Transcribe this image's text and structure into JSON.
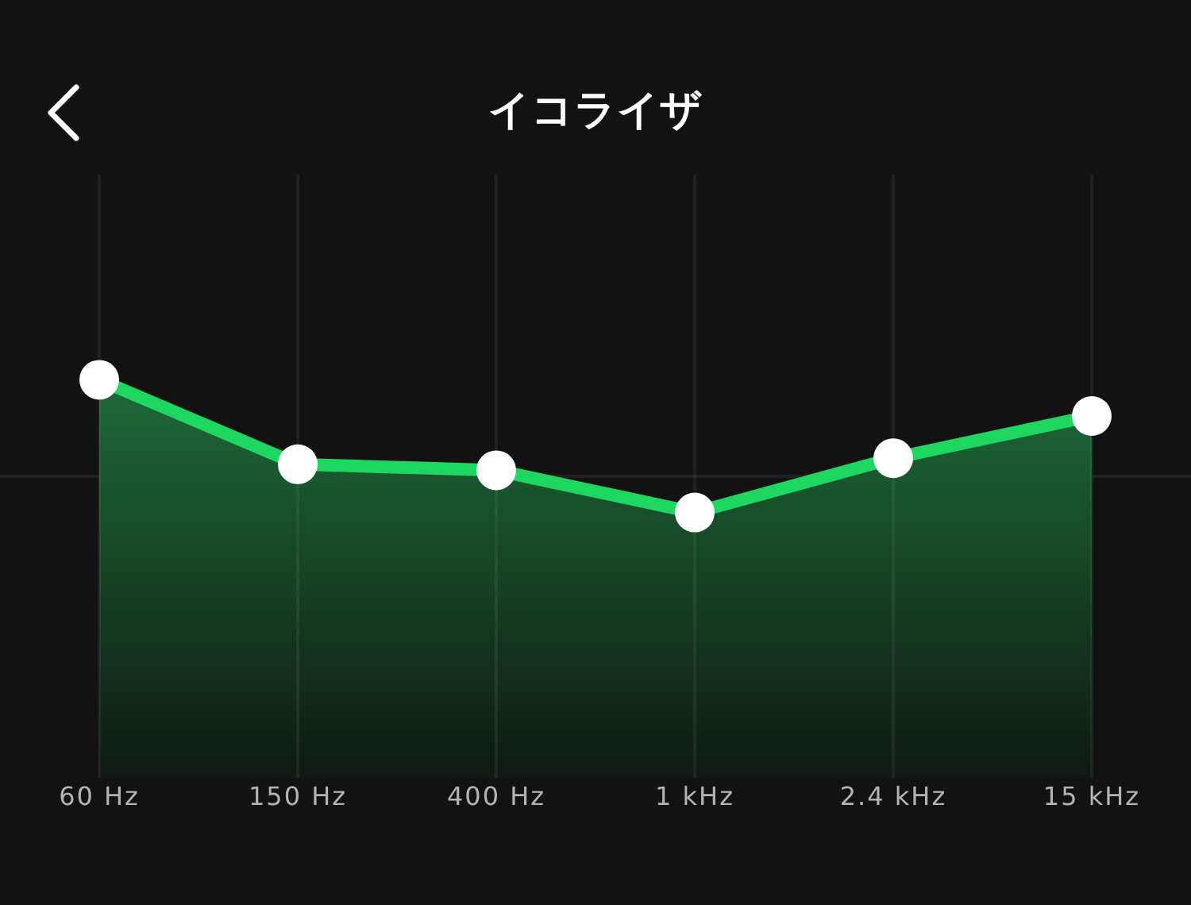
{
  "header": {
    "title": "イコライザ"
  },
  "bands": [
    {
      "label": "60 Hz",
      "level": 0.66
    },
    {
      "label": "150 Hz",
      "level": 0.52
    },
    {
      "label": "400 Hz",
      "level": 0.51
    },
    {
      "label": "1 kHz",
      "level": 0.44
    },
    {
      "label": "2.4 kHz",
      "level": 0.53
    },
    {
      "label": "15 kHz",
      "level": 0.6
    }
  ]
}
